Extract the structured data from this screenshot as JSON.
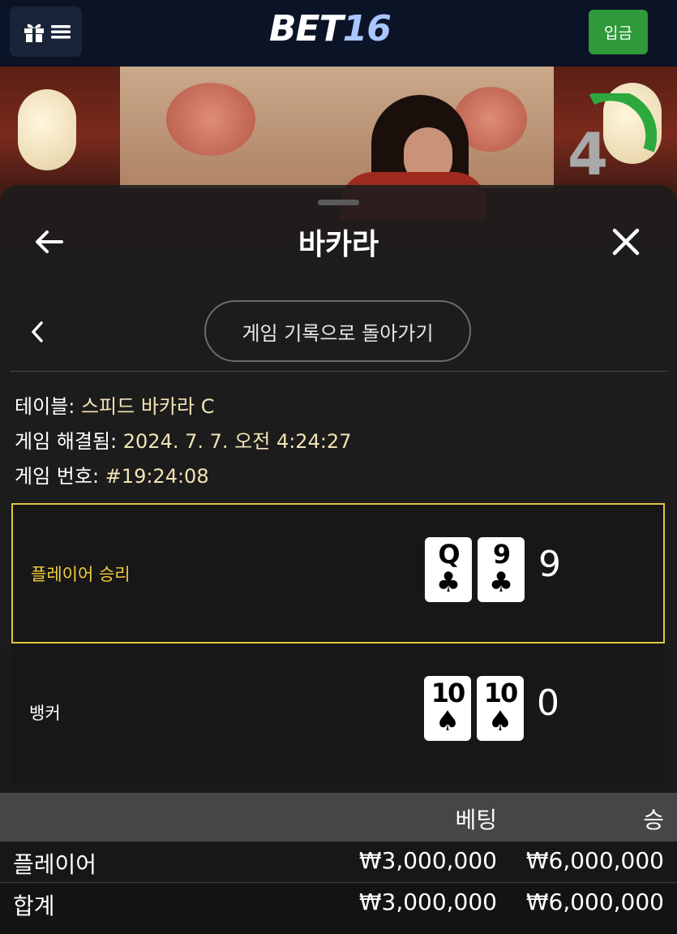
{
  "header": {
    "logo_main": "BET",
    "logo_num": "16",
    "deposit_label": "입금"
  },
  "video": {
    "countdown": "4"
  },
  "sheet": {
    "title": "바카라",
    "history_button_label": "게임 기록으로 돌아가기",
    "table_label": "테이블:",
    "table_value": "스피드 바카라 C",
    "resolved_label": "게임 해결됨:",
    "resolved_value": "2024. 7. 7. 오전 4:24:27",
    "game_no_label": "게임 번호:",
    "game_no_value": "#19:24:08"
  },
  "results": {
    "player": {
      "label": "플레이어 승리",
      "cards": [
        {
          "rank": "Q",
          "suit": "♣"
        },
        {
          "rank": "9",
          "suit": "♣"
        }
      ],
      "score": "9"
    },
    "banker": {
      "label": "뱅커",
      "cards": [
        {
          "rank": "10",
          "suit": "♠"
        },
        {
          "rank": "10",
          "suit": "♠"
        }
      ],
      "score": "0"
    }
  },
  "bets": {
    "header_bet": "베팅",
    "header_win": "승",
    "rows": [
      {
        "name": "플레이어",
        "bet": "₩3,000,000",
        "win": "₩6,000,000"
      },
      {
        "name": "합계",
        "bet": "₩3,000,000",
        "win": "₩6,000,000"
      }
    ]
  },
  "colors": {
    "header_bg": "#0b1326",
    "deposit_green": "#2e9a3a",
    "win_highlight": "#e1c442",
    "info_value": "#f1e3b5"
  }
}
